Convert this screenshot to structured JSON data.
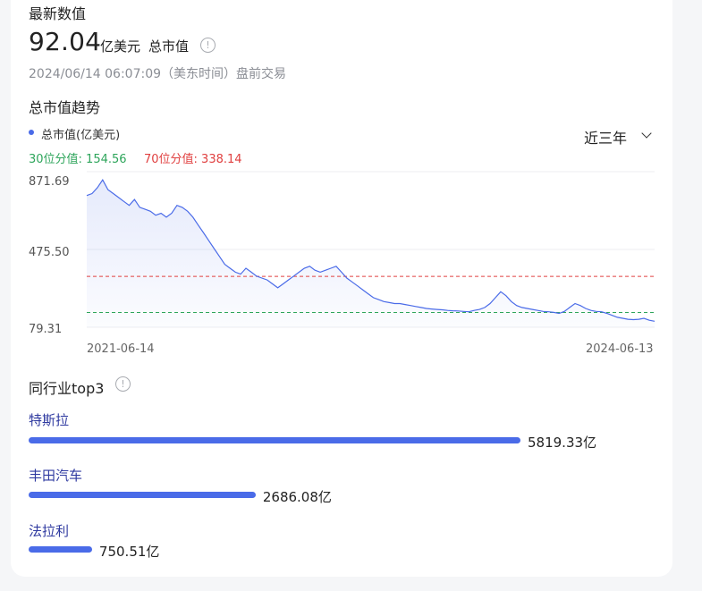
{
  "latest": {
    "title": "最新数值",
    "value": "92.04",
    "unit": "亿美元",
    "metric": "总市值",
    "timestamp": "2024/06/14 06:07:09（美东时间）盘前交易"
  },
  "trend": {
    "title": "总市值趋势",
    "legend": "总市值(亿美元)",
    "p30_label": "30位分值: 154.56",
    "p70_label": "70位分值: 338.14",
    "range": "近三年",
    "colors": {
      "line": "#4a6be8",
      "p30": "#2ea55b",
      "p70": "#e04040"
    }
  },
  "chart_data": {
    "type": "line",
    "y_ticks": [
      "871.69",
      "475.50",
      "79.31"
    ],
    "x_ticks": [
      "2021-06-14",
      "2024-06-13"
    ],
    "ylim": [
      79.31,
      871.69
    ],
    "p30": 154.56,
    "p70": 338.14,
    "series": [
      {
        "values": [
          750,
          760,
          790,
          830,
          780,
          760,
          740,
          720,
          700,
          730,
          690,
          680,
          670,
          650,
          660,
          640,
          660,
          700,
          690,
          670,
          640,
          600,
          560,
          520,
          480,
          440,
          400,
          380,
          360,
          350,
          380,
          360,
          340,
          330,
          320,
          300,
          280,
          300,
          320,
          340,
          360,
          380,
          390,
          370,
          360,
          370,
          380,
          390,
          360,
          330,
          310,
          290,
          270,
          250,
          230,
          220,
          210,
          205,
          200,
          200,
          195,
          190,
          185,
          180,
          175,
          172,
          170,
          168,
          165,
          163,
          162,
          160,
          158,
          165,
          170,
          180,
          200,
          230,
          260,
          240,
          210,
          190,
          180,
          175,
          170,
          165,
          160,
          158,
          155,
          150,
          160,
          180,
          200,
          190,
          175,
          165,
          160,
          158,
          150,
          140,
          130,
          125,
          120,
          118,
          120,
          125,
          115,
          110
        ]
      }
    ]
  },
  "peers": {
    "title": "同行业top3",
    "items": [
      {
        "name": "特斯拉",
        "value": 5819.33,
        "label": "5819.33亿"
      },
      {
        "name": "丰田汽车",
        "value": 2686.08,
        "label": "2686.08亿"
      },
      {
        "name": "法拉利",
        "value": 750.51,
        "label": "750.51亿"
      }
    ]
  }
}
